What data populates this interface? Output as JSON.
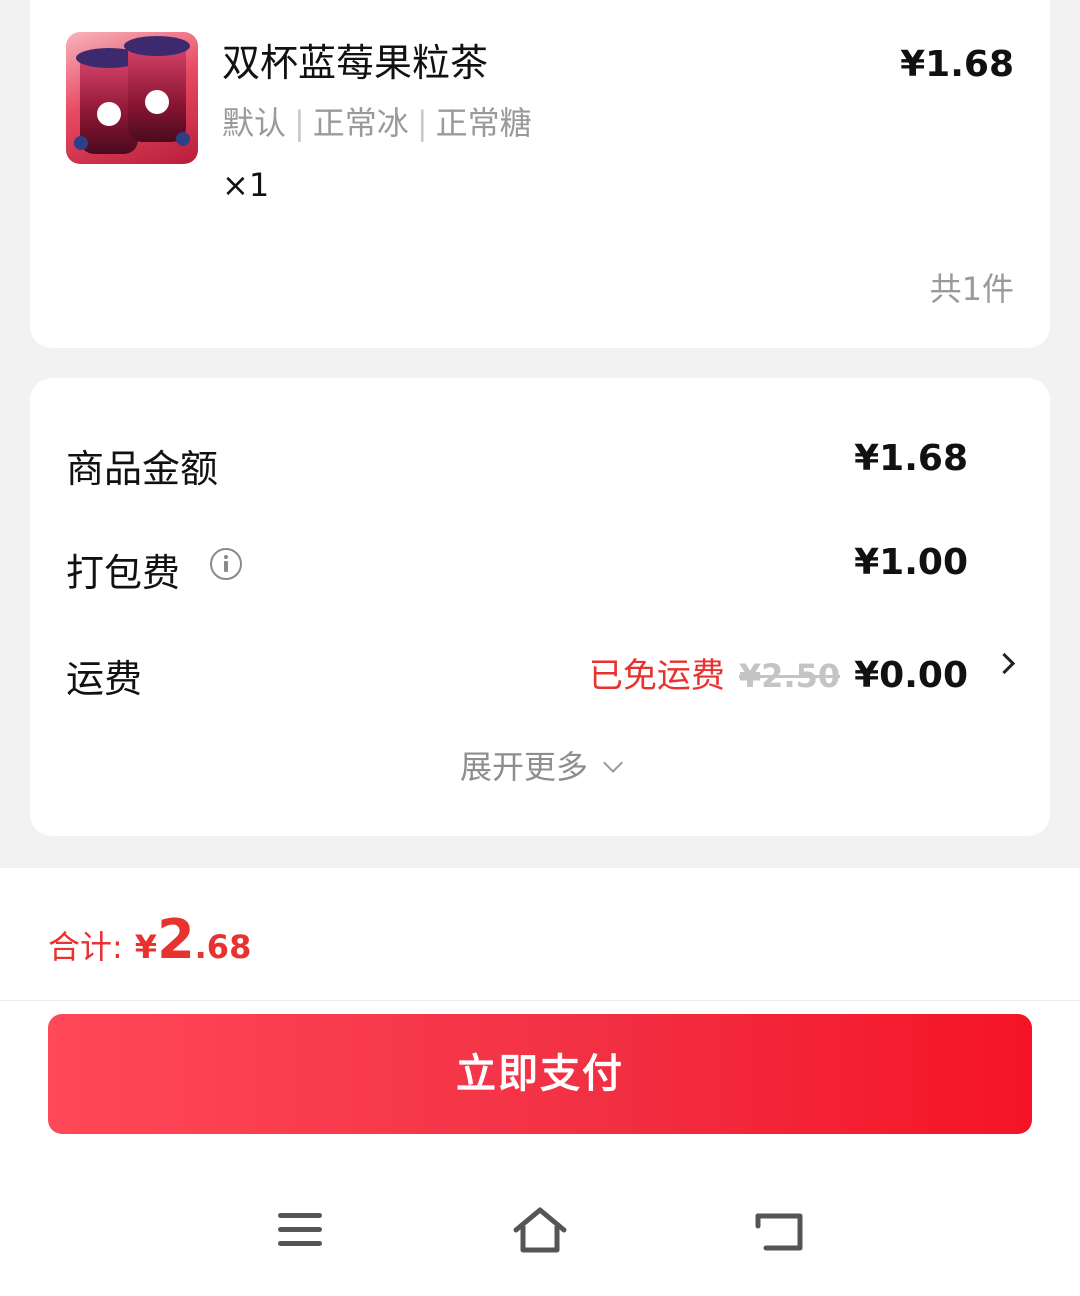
{
  "product": {
    "name": "双杯蓝莓果粒茶",
    "price": "¥1.68",
    "specs": [
      "默认",
      "正常冰",
      "正常糖"
    ],
    "quantity": "×1",
    "item_count": "共1件",
    "thumbnail_icon": "blueberry-tea-cups-image"
  },
  "fees": {
    "goods_label": "商品金额",
    "goods_value": "¥1.68",
    "packing_label": "打包费",
    "packing_value": "¥1.00",
    "shipping_label": "运费",
    "shipping_free_text": "已免运费",
    "shipping_original": "¥2.50",
    "shipping_value": "¥0.00",
    "expand_label": "展开更多"
  },
  "footer": {
    "total_label": "合计:",
    "total_currency": "¥",
    "total_int": "2",
    "total_dec": ".68",
    "pay_button": "立即支付"
  },
  "colors": {
    "accent_red": "#e8322f",
    "button_start": "#ff4858",
    "button_end": "#f51426"
  },
  "system_nav": {
    "icons": [
      "menu-icon",
      "home-icon",
      "back-icon"
    ]
  }
}
